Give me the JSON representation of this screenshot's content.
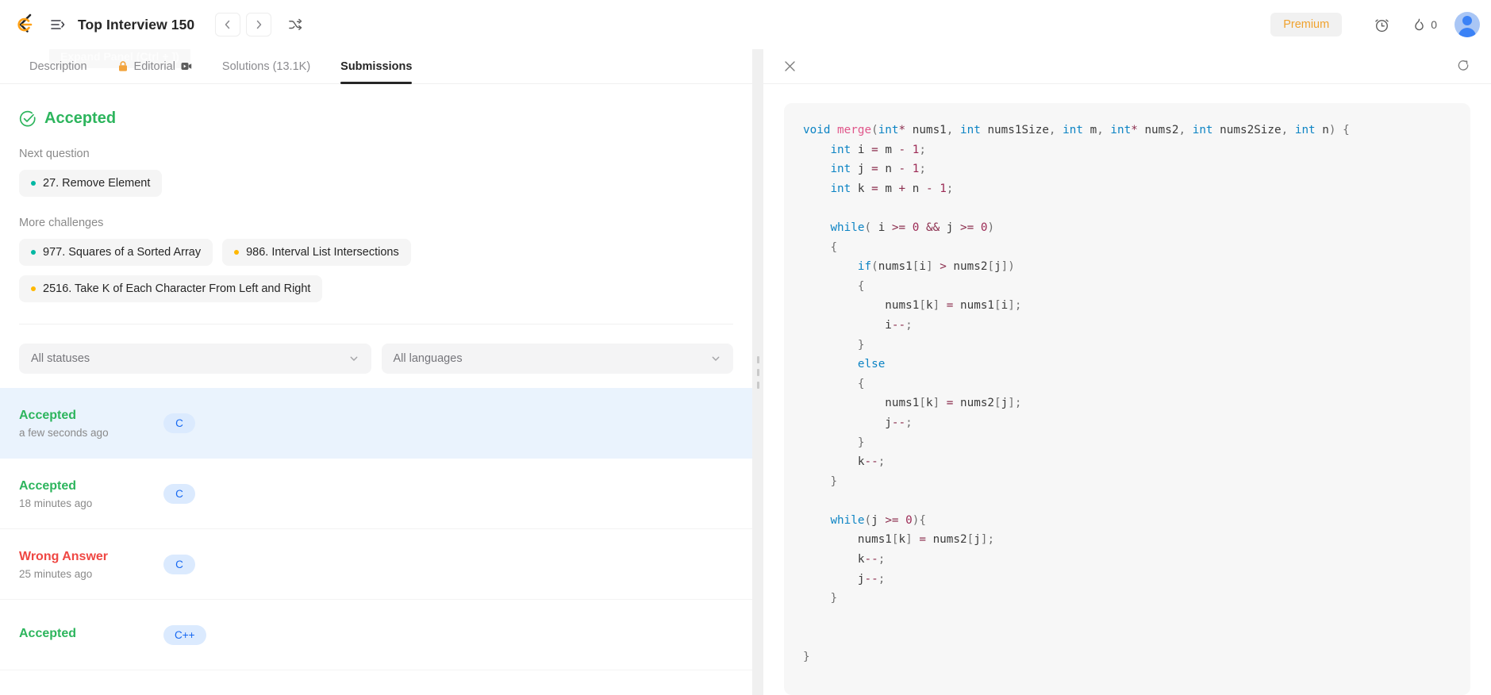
{
  "header": {
    "logo_icon": "leetcode-logo-icon",
    "menu_icon": "list-menu-icon",
    "title": "Top Interview 150",
    "prev_label": "‹",
    "next_label": "›",
    "shuffle_icon": "shuffle-icon",
    "premium_label": "Premium",
    "timer_icon": "alarm-clock-icon",
    "streak_icon": "flame-icon",
    "streak_count": "0",
    "avatar_icon": "user-avatar"
  },
  "tooltip": {
    "text": "Expand Panel (Ctrl + ])"
  },
  "tabs": [
    {
      "label": "Description",
      "icon": "",
      "trailing_icon": "",
      "active": false
    },
    {
      "label": "Editorial",
      "icon": "lock-icon",
      "trailing_icon": "video-icon",
      "active": false
    },
    {
      "label": "Solutions (13.1K)",
      "icon": "",
      "trailing_icon": "",
      "active": false
    },
    {
      "label": "Submissions",
      "icon": "",
      "trailing_icon": "",
      "active": true
    }
  ],
  "result": {
    "status": "Accepted",
    "status_icon": "check-circle-icon",
    "status_color": "#2db55d"
  },
  "next_question": {
    "label": "Next question",
    "items": [
      {
        "title": "27. Remove Element",
        "difficulty": "easy",
        "dot_color": "#00b8a3"
      }
    ]
  },
  "more_challenges": {
    "label": "More challenges",
    "items": [
      {
        "title": "977. Squares of a Sorted Array",
        "difficulty": "easy",
        "dot_color": "#00b8a3"
      },
      {
        "title": "986. Interval List Intersections",
        "difficulty": "medium",
        "dot_color": "#ffb800"
      },
      {
        "title": "2516. Take K of Each Character From Left and Right",
        "difficulty": "medium",
        "dot_color": "#ffb800"
      }
    ]
  },
  "filters": {
    "status": {
      "value": "All statuses",
      "caret_icon": "chevron-down-icon"
    },
    "language": {
      "value": "All languages",
      "caret_icon": "chevron-down-icon"
    }
  },
  "submissions": [
    {
      "status": "Accepted",
      "state": "ok",
      "time": "a few seconds ago",
      "language": "C",
      "selected": true
    },
    {
      "status": "Accepted",
      "state": "ok",
      "time": "18 minutes ago",
      "language": "C",
      "selected": false
    },
    {
      "status": "Wrong Answer",
      "state": "bad",
      "time": "25 minutes ago",
      "language": "C",
      "selected": false
    },
    {
      "status": "Accepted",
      "state": "ok",
      "time": "",
      "language": "C++",
      "selected": false
    }
  ],
  "code_panel": {
    "close_icon": "close-icon",
    "share_icon": "share-external-icon",
    "language": "C",
    "code": "void merge(int* nums1, int nums1Size, int m, int* nums2, int nums2Size, int n) {\n    int i = m - 1;\n    int j = n - 1;\n    int k = m + n - 1;\n\n    while( i >= 0 && j >= 0)\n    {\n        if(nums1[i] > nums2[j])\n        {\n            nums1[k] = nums1[i];\n            i--;\n        }\n        else\n        {\n            nums1[k] = nums2[j];\n            j--;\n        }\n        k--;\n    }\n\n    while(j >= 0){\n        nums1[k] = nums2[j];\n        k--;\n        j--;\n    }\n\n\n}"
  },
  "colors": {
    "accent_orange": "#ffa116",
    "accepted_green": "#2db55d",
    "wrong_red": "#ef4743",
    "lang_pill_bg": "#dbeafe",
    "lang_pill_fg": "#1668f2",
    "selected_row_bg": "#eaf3fd"
  }
}
